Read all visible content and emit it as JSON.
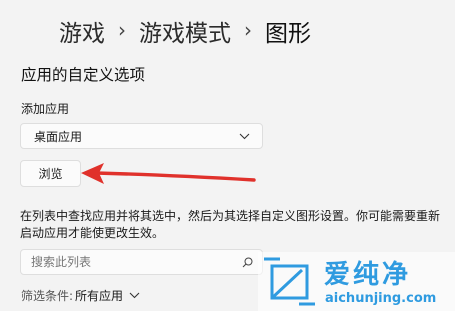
{
  "breadcrumb": {
    "items": [
      "游戏",
      "游戏模式",
      "图形"
    ],
    "separator": "›"
  },
  "section": {
    "title": "应用的自定义选项"
  },
  "add_app": {
    "label": "添加应用",
    "dropdown_value": "桌面应用",
    "browse_label": "浏览"
  },
  "description": "在列表中查找应用并将其选中，然后为其选择自定义图形设置。你可能需要重新启动应用才能使更改生效。",
  "search": {
    "placeholder": "搜索此列表"
  },
  "filter": {
    "label": "筛选条件:",
    "value": "所有应用"
  },
  "annotation": {
    "arrow_color": "#e0312b"
  },
  "watermark": {
    "title": "爱纯净",
    "url": "aichunjing.com",
    "color": "#2f9be0"
  }
}
